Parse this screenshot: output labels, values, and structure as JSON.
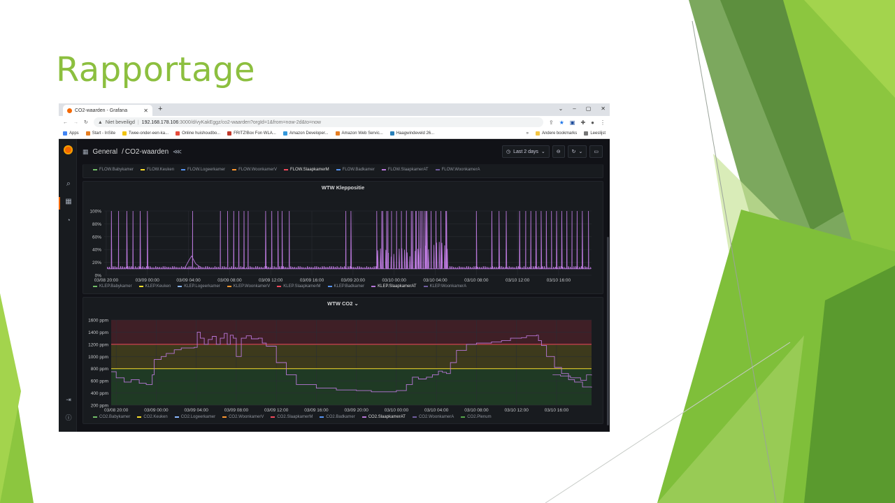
{
  "slide": {
    "title": "Rapportage",
    "colors": {
      "title": "#8cbf3f",
      "green_dark": "#4e8a2a",
      "green_light": "#a8d45a"
    }
  },
  "browser": {
    "tab_title": "CO2-waarden - Grafana",
    "tab_close": "✕",
    "new_tab": "+",
    "window_controls": [
      "⌄",
      "–",
      "▢",
      "✕"
    ],
    "security_label": "Niet beveiligd",
    "url_host": "192.168.178.106",
    "url_path": ":3000/d/vyKakEggz/co2-waarden?orgId=1&from=now-2d&to=now",
    "bookmarks": [
      {
        "label": "Apps",
        "color": "#4285f4"
      },
      {
        "label": "Start - InSite",
        "color": "#e67e22"
      },
      {
        "label": "Twee-onder-een-ka...",
        "color": "#f1c40f"
      },
      {
        "label": "Online huishoudbo...",
        "color": "#e74c3c"
      },
      {
        "label": "FRITZ!Box Fon WLA...",
        "color": "#c0392b"
      },
      {
        "label": "Amazon Developer...",
        "color": "#3498db"
      },
      {
        "label": "Amazon Web Servic...",
        "color": "#e67e22"
      },
      {
        "label": "Haagwindeveld 26...",
        "color": "#2980b9"
      }
    ],
    "bookmarks_more": "»",
    "other_bookmarks": "Andere bookmarks",
    "reading_list": "Leeslijst"
  },
  "grafana": {
    "breadcrumb_folder": "General",
    "breadcrumb_separator": "/",
    "breadcrumb_dashboard": "CO2-waarden",
    "time_range": "Last 2 days",
    "icons": {
      "logo": "grafana-logo",
      "search": "search-icon",
      "dashboards": "dashboards-icon",
      "alerts": "bell-icon",
      "signin": "sign-in-icon",
      "help": "help-icon"
    },
    "flow_legend": [
      {
        "label": "FLOW.Babykamer",
        "color": "#73bf69"
      },
      {
        "label": "FLOW.Keuken",
        "color": "#fade2a"
      },
      {
        "label": "FLOW.Logeerkamer",
        "color": "#5794f2"
      },
      {
        "label": "FLOW.WoonkamerV",
        "color": "#ff9830"
      },
      {
        "label": "FLOW.SlaapkamerM",
        "color": "#f2495c",
        "highlight": true
      },
      {
        "label": "FLOW.Badkamer",
        "color": "#5794f2"
      },
      {
        "label": "FLOW.SlaapkamerAT",
        "color": "#b877d9"
      },
      {
        "label": "FLOW.WoonkamerA",
        "color": "#705da0"
      }
    ],
    "klep_legend": [
      {
        "label": "KLEP.Babykamer",
        "color": "#73bf69"
      },
      {
        "label": "KLEP.Keuken",
        "color": "#fade2a"
      },
      {
        "label": "KLEP.Logeerkamer",
        "color": "#8ab8ff"
      },
      {
        "label": "KLEP.WoonkamerV",
        "color": "#ff9830"
      },
      {
        "label": "KLEP.SlaapkamerM",
        "color": "#f2495c"
      },
      {
        "label": "KLEP.Badkamer",
        "color": "#5794f2"
      },
      {
        "label": "KLEP.SlaapkamerAT",
        "color": "#b877d9",
        "highlight": true
      },
      {
        "label": "KLEP.WoonkamerA",
        "color": "#705da0"
      }
    ],
    "co2_legend": [
      {
        "label": "CO2.Babykamer",
        "color": "#73bf69"
      },
      {
        "label": "CO2.Keuken",
        "color": "#fade2a"
      },
      {
        "label": "CO2.Logeerkamer",
        "color": "#8ab8ff"
      },
      {
        "label": "CO2.WoonkamerV",
        "color": "#ff9830"
      },
      {
        "label": "CO2.SlaapkamerM",
        "color": "#f2495c"
      },
      {
        "label": "CO2.Badkamer",
        "color": "#5794f2"
      },
      {
        "label": "CO2.SlaapkamerAT",
        "color": "#b877d9",
        "highlight": true
      },
      {
        "label": "CO2.WoonkamerA",
        "color": "#705da0"
      },
      {
        "label": "CO2.Plenum",
        "color": "#56a64b"
      }
    ]
  },
  "chart_data": [
    {
      "type": "line",
      "title": "WTW Kleppositie",
      "ylim": [
        0,
        100
      ],
      "yticks": [
        "0%",
        "20%",
        "40%",
        "60%",
        "80%",
        "100%"
      ],
      "ytick_values": [
        0,
        20,
        40,
        60,
        80,
        100
      ],
      "xticks": [
        "03/08 20:00",
        "03/09 00:00",
        "03/09 04:00",
        "03/09 08:00",
        "03/09 12:00",
        "03/09 16:00",
        "03/09 20:00",
        "03/10 00:00",
        "03/10 04:00",
        "03/10 08:00",
        "03/10 12:00",
        "03/10 16:00"
      ],
      "xlim_hours": [
        -0.2,
        47.2
      ],
      "baseline": 10,
      "series_color": "#b877d9",
      "spike_hours": [
        0.5,
        1.2,
        2.0,
        2.6,
        3.3,
        4.0,
        8.4,
        11.1,
        11.8,
        12.4,
        12.9,
        13.4,
        13.8,
        15.5,
        16.1,
        16.7,
        17.1,
        17.8,
        23.3,
        23.8,
        26.9,
        27.4,
        29.2,
        29.8,
        30.1,
        30.4,
        30.6,
        30.8,
        31.0,
        31.2,
        33.1,
        36.0,
        37.5,
        38.2,
        38.9,
        40.2,
        40.8,
        41.3,
        41.8,
        42.3,
        42.8,
        43.3,
        43.8,
        44.3,
        44.8,
        45.3,
        45.8,
        46.3,
        46.9
      ],
      "dense_hours": [
        26.3,
        33.2
      ],
      "dense_step": 0.26
    },
    {
      "type": "line",
      "title": "WTW CO2",
      "ylim": [
        200,
        1600
      ],
      "yticks": [
        "200 ppm",
        "400 ppm",
        "600 ppm",
        "800 ppm",
        "1000 ppm",
        "1200 ppm",
        "1400 ppm",
        "1600 ppm"
      ],
      "ytick_values": [
        200,
        400,
        600,
        800,
        1000,
        1200,
        1400,
        1600
      ],
      "xticks": [
        "03/08 20:00",
        "03/09 00:00",
        "03/09 04:00",
        "03/09 08:00",
        "03/09 12:00",
        "03/09 16:00",
        "03/09 20:00",
        "03/10 00:00",
        "03/10 04:00",
        "03/10 08:00",
        "03/10 12:00",
        "03/10 16:00"
      ],
      "xlim_hours": [
        -0.5,
        47.5
      ],
      "thresholds": [
        {
          "value": 800,
          "color": "#fade2a"
        },
        {
          "value": 1200,
          "color": "#f2495c"
        }
      ],
      "series": [
        {
          "name": "CO2.SlaapkamerAT",
          "color": "#b877d9",
          "points": [
            [
              -0.5,
              750
            ],
            [
              0,
              650
            ],
            [
              0.8,
              580
            ],
            [
              1.5,
              620
            ],
            [
              2.3,
              560
            ],
            [
              3,
              540
            ],
            [
              3.6,
              700
            ],
            [
              3.8,
              950
            ],
            [
              4.5,
              1000
            ],
            [
              5,
              1050
            ],
            [
              5.8,
              1110
            ],
            [
              6.5,
              1140
            ],
            [
              7.2,
              1140
            ],
            [
              7.8,
              1150
            ],
            [
              8.1,
              1400
            ],
            [
              8.4,
              1300
            ],
            [
              8.8,
              1200
            ],
            [
              9.2,
              1280
            ],
            [
              9.6,
              1330
            ],
            [
              10,
              1200
            ],
            [
              10.4,
              1300
            ],
            [
              10.8,
              1380
            ],
            [
              11.1,
              1200
            ],
            [
              11.4,
              1350
            ],
            [
              11.7,
              1300
            ],
            [
              12,
              1000
            ],
            [
              12.5,
              1300
            ],
            [
              13,
              1340
            ],
            [
              13.5,
              1290
            ],
            [
              14.2,
              1300
            ],
            [
              14.6,
              1220
            ],
            [
              15,
              1170
            ],
            [
              16,
              900
            ],
            [
              17,
              700
            ],
            [
              18,
              540
            ],
            [
              20,
              480
            ],
            [
              22,
              450
            ],
            [
              24,
              440
            ],
            [
              25.5,
              420
            ],
            [
              27,
              420
            ],
            [
              28,
              440
            ],
            [
              29,
              540
            ],
            [
              29.6,
              660
            ],
            [
              30.2,
              630
            ],
            [
              31,
              660
            ],
            [
              31.6,
              700
            ],
            [
              32.2,
              760
            ],
            [
              32.6,
              740
            ],
            [
              33,
              720
            ],
            [
              33.4,
              900
            ],
            [
              34,
              1100
            ],
            [
              35,
              1200
            ],
            [
              36,
              1220
            ],
            [
              37.5,
              1240
            ],
            [
              38.5,
              1260
            ],
            [
              39.4,
              1300
            ],
            [
              40.5,
              1310
            ],
            [
              41,
              1340
            ],
            [
              42,
              1350
            ],
            [
              42.2,
              1260
            ],
            [
              42.5,
              1180
            ],
            [
              43,
              1000
            ],
            [
              43.8,
              820
            ],
            [
              44.5,
              720
            ],
            [
              45.2,
              620
            ],
            [
              45.8,
              580
            ],
            [
              46.6,
              500
            ],
            [
              47.5,
              490
            ]
          ]
        }
      ],
      "extra_series_tail": {
        "name": "CO2.SlaapkamerAT",
        "points": [
          [
            43.6,
            700
          ],
          [
            44.4,
            680
          ],
          [
            45.4,
            650
          ],
          [
            46.4,
            610
          ],
          [
            47.0,
            700
          ],
          [
            47.5,
            690
          ]
        ]
      }
    }
  ]
}
